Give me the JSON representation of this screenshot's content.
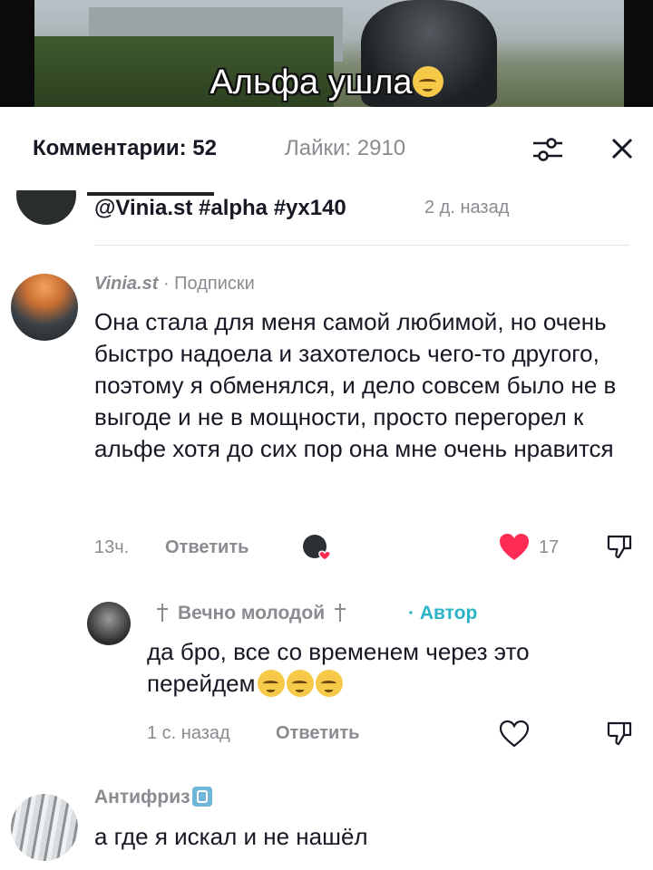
{
  "video": {
    "caption": "Альфа ушла",
    "caption_emoji": "pensive-face"
  },
  "header": {
    "comments_label": "Комментарии: 52",
    "likes_label": "Лайки: 2910",
    "filter_icon": "sliders-icon",
    "close_icon": "close-icon"
  },
  "caption_row": {
    "text": "@Vinia.st #alpha #yx140",
    "time": "2 д. назад"
  },
  "comments": [
    {
      "username": "Vinia.st",
      "relation": "· Подписки",
      "text": "Она стала для меня самой любимой, но очень быстро надоела и захотелось чего-то другого, поэтому я обменялся, и дело совсем было не в выгоде и не в мощности, просто перегорел к альфе хотя до сих пор она мне очень нравится",
      "time": "13ч.",
      "reply_label": "Ответить",
      "likes": "17",
      "liked": true,
      "heart_color": "#fe2c55"
    },
    {
      "username": "Вечно молодой",
      "author_badge": "· Автор",
      "badge_color": "#2bb3c7",
      "text": "да бро, все со временем через это перейдем",
      "emojis": [
        "pensive-face",
        "pensive-face",
        "pensive-face"
      ],
      "time": "1 с. назад",
      "reply_label": "Ответить",
      "liked": false
    },
    {
      "username": "Антифриз",
      "username_icon": "x-ray-icon",
      "text": "а где я искал и не нашёл"
    }
  ]
}
